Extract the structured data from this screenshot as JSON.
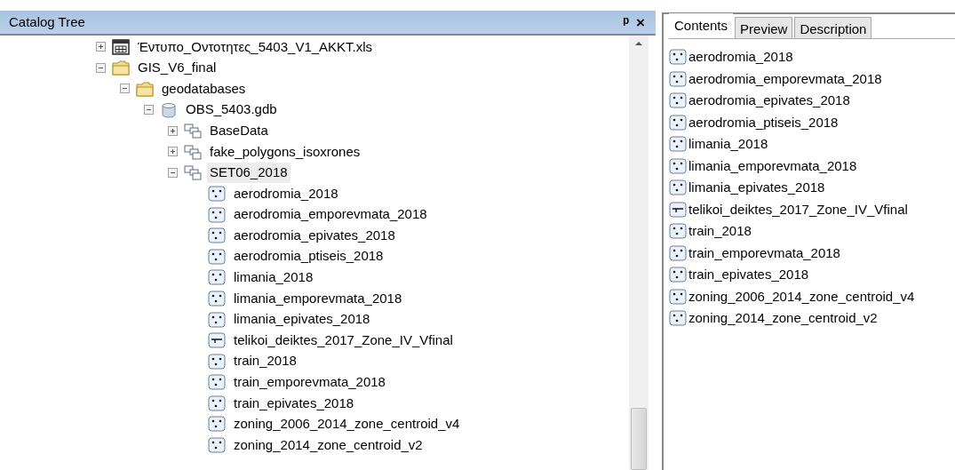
{
  "catalog_tree": {
    "title": "Catalog Tree",
    "pin_glyph": "ᵖ",
    "close_glyph": "×",
    "items": [
      {
        "label": "Έντυπο_Οντοτητες_5403_V1_AKKT.xls",
        "kind": "table",
        "expanded": false,
        "selected": false
      },
      {
        "label": "GIS_V6_final",
        "kind": "folder",
        "expanded": true,
        "selected": false,
        "children": [
          {
            "label": "geodatabases",
            "kind": "folder",
            "expanded": true,
            "selected": false,
            "children": [
              {
                "label": "OBS_5403.gdb",
                "kind": "database",
                "expanded": true,
                "selected": false,
                "children": [
                  {
                    "label": "BaseData",
                    "kind": "dataset",
                    "expanded": false,
                    "selected": false
                  },
                  {
                    "label": "fake_polygons_isoxrones",
                    "kind": "dataset",
                    "expanded": false,
                    "selected": false
                  },
                  {
                    "label": "SET06_2018",
                    "kind": "dataset",
                    "expanded": true,
                    "selected": true,
                    "children": [
                      {
                        "label": "aerodromia_2018",
                        "kind": "point",
                        "selected": false
                      },
                      {
                        "label": "aerodromia_emporevmata_2018",
                        "kind": "point",
                        "selected": false
                      },
                      {
                        "label": "aerodromia_epivates_2018",
                        "kind": "point",
                        "selected": false
                      },
                      {
                        "label": "aerodromia_ptiseis_2018",
                        "kind": "point",
                        "selected": false
                      },
                      {
                        "label": "limania_2018",
                        "kind": "point",
                        "selected": false
                      },
                      {
                        "label": "limania_emporevmata_2018",
                        "kind": "point",
                        "selected": false
                      },
                      {
                        "label": "limania_epivates_2018",
                        "kind": "point",
                        "selected": false
                      },
                      {
                        "label": "telikoi_deiktes_2017_Zone_IV_Vfinal",
                        "kind": "line",
                        "selected": false
                      },
                      {
                        "label": "train_2018",
                        "kind": "point",
                        "selected": false
                      },
                      {
                        "label": "train_emporevmata_2018",
                        "kind": "point",
                        "selected": false
                      },
                      {
                        "label": "train_epivates_2018",
                        "kind": "point",
                        "selected": false
                      },
                      {
                        "label": "zoning_2006_2014_zone_centroid_v4",
                        "kind": "point",
                        "selected": false
                      },
                      {
                        "label": "zoning_2014_zone_centroid_v2",
                        "kind": "point",
                        "selected": false
                      }
                    ]
                  }
                ]
              }
            ]
          }
        ]
      }
    ]
  },
  "tabs": [
    {
      "label": "Contents",
      "selected": true
    },
    {
      "label": "Preview",
      "selected": false
    },
    {
      "label": "Description",
      "selected": false
    }
  ],
  "contents": [
    {
      "label": "aerodromia_2018",
      "kind": "point",
      "selected": false
    },
    {
      "label": "aerodromia_emporevmata_2018",
      "kind": "point",
      "selected": false
    },
    {
      "label": "aerodromia_epivates_2018",
      "kind": "point",
      "selected": false
    },
    {
      "label": "aerodromia_ptiseis_2018",
      "kind": "point",
      "selected": false
    },
    {
      "label": "limania_2018",
      "kind": "point",
      "selected": false
    },
    {
      "label": "limania_emporevmata_2018",
      "kind": "point",
      "selected": false
    },
    {
      "label": "limania_epivates_2018",
      "kind": "point",
      "selected": false
    },
    {
      "label": "telikoi_deiktes_2017_Zone_IV_Vfinal",
      "kind": "line",
      "selected": false
    },
    {
      "label": "train_2018",
      "kind": "point",
      "selected": false
    },
    {
      "label": "train_emporevmata_2018",
      "kind": "point",
      "selected": false
    },
    {
      "label": "train_epivates_2018",
      "kind": "point",
      "selected": false
    },
    {
      "label": "zoning_2006_2014_zone_centroid_v4",
      "kind": "point",
      "selected": false
    },
    {
      "label": "zoning_2014_zone_centroid_v2",
      "kind": "point",
      "selected": false
    }
  ]
}
